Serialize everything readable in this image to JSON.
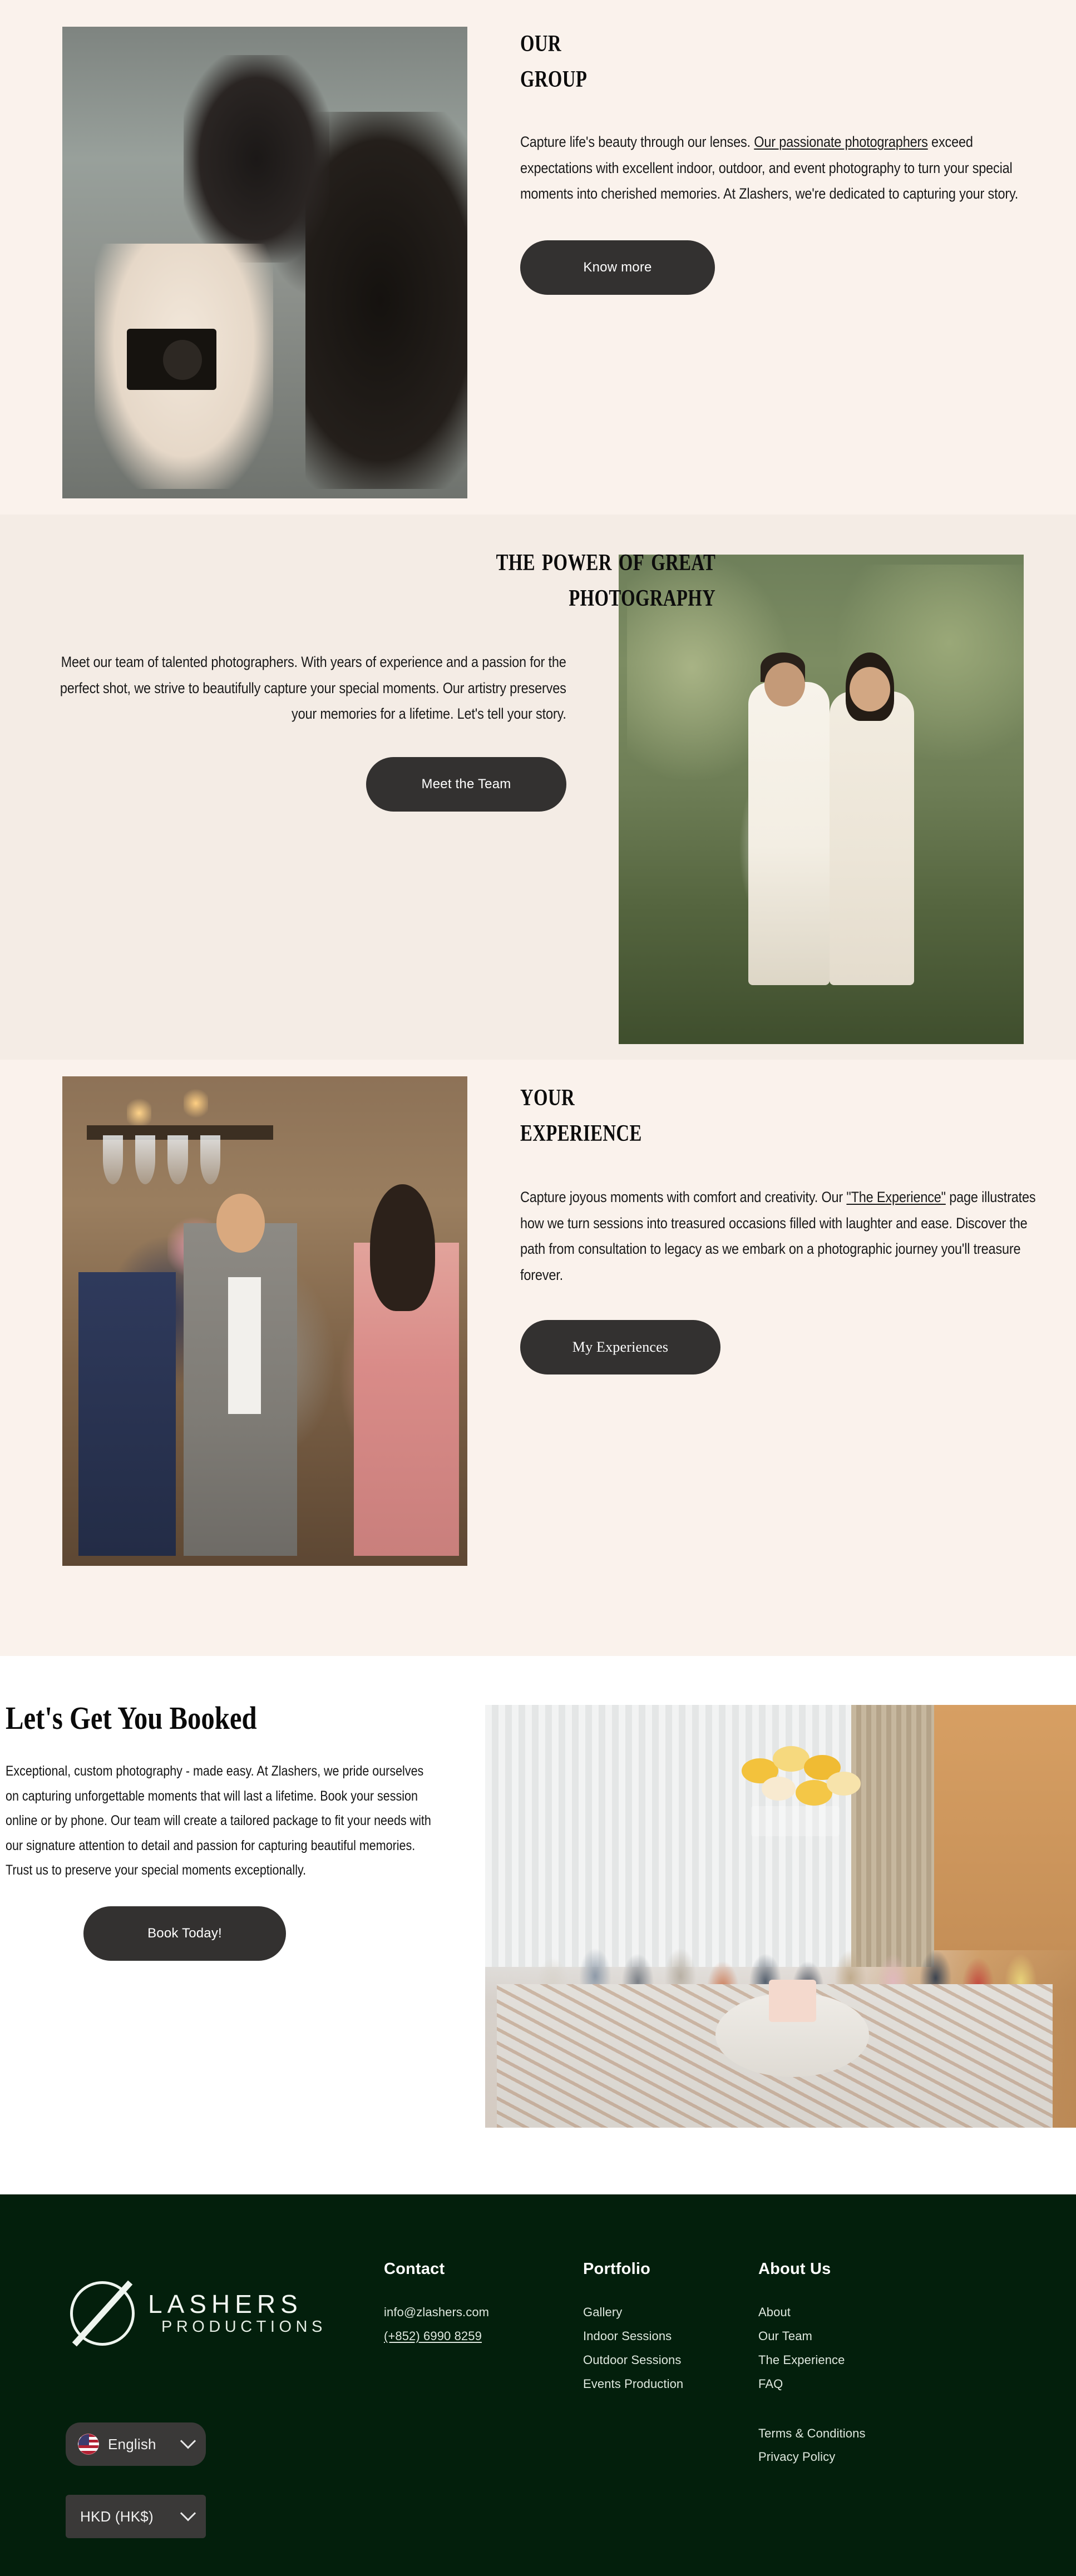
{
  "brand": {
    "name": "Zlashers",
    "logo_line1": "LASHERS",
    "logo_line2": "PRODUCTIONS"
  },
  "sections": {
    "group": {
      "heading_line1": "Our",
      "heading_line2": "Group",
      "body_part1": "Capture life's beauty through our lenses. ",
      "body_link": "Our passionate photographers",
      "body_part2": " exceed expectations with excellent indoor, outdoor, and event photography to turn your special moments into cherished memories. At Zlashers, we're dedicated to capturing your story.",
      "button": "Know more"
    },
    "power": {
      "heading_line1": "The power of great",
      "heading_line2": "photography",
      "body": "Meet our team of talented photographers. With years of experience and a passion for the perfect shot, we strive to beautifully capture your special moments. Our artistry preserves your memories for a lifetime. Let's tell your story.",
      "button": "Meet the Team"
    },
    "experience": {
      "heading_line1": "Your",
      "heading_line2": "Experience",
      "body_part1": "Capture joyous moments with comfort and creativity. Our ",
      "body_link": "\"The Experience\"",
      "body_part2": " page illustrates how we turn sessions into treasured occasions filled with laughter and ease. Discover the path from consultation to legacy as we embark on a photographic journey you'll treasure forever.",
      "button": "My Experiences"
    },
    "booked": {
      "heading": "Let's Get You Booked",
      "body": "Exceptional, custom photography - made easy. At Zlashers, we pride ourselves on capturing unforgettable moments that will last a lifetime. Book your session online or by phone. Our team will create a tailored package to fit your needs with our signature attention to detail and passion for capturing beautiful memories. Trust us to preserve your special moments exceptionally.",
      "button": "Book Today!"
    }
  },
  "footer": {
    "contact": {
      "title": "Contact",
      "email": "info@zlashers.com",
      "phone": "(+852) 6990 8259"
    },
    "portfolio": {
      "title": "Portfolio",
      "links": [
        "Gallery",
        "Indoor Sessions",
        "Outdoor Sessions",
        "Events Production"
      ]
    },
    "about": {
      "title": "About Us",
      "links": [
        "About",
        "Our Team",
        "The Experience",
        "FAQ"
      ],
      "legal": [
        "Terms & Conditions",
        "Privacy Policy"
      ]
    },
    "language_selector": {
      "label": "English",
      "flag": "us-flag-icon"
    },
    "currency_selector": {
      "label": "HKD (HK$)"
    }
  },
  "colors": {
    "section1_bg": "#faf2ec",
    "section2_bg": "#f4ece5",
    "section4_bg": "#ffffff",
    "footer_bg": "#031f0c",
    "button_bg": "#333130",
    "text": "#1a1a1a"
  }
}
